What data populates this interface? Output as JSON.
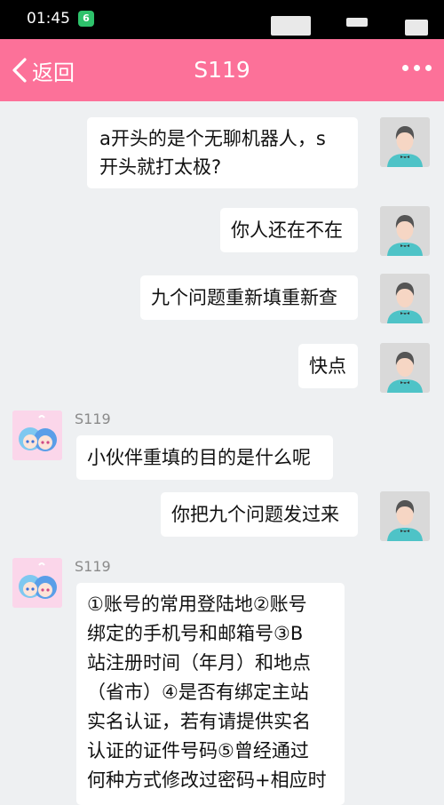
{
  "status_bar": {
    "time": "01:45",
    "app_badge": "6"
  },
  "header": {
    "back_label": "返回",
    "title": "S119"
  },
  "messages": [
    {
      "side": "right",
      "text": "a开头的是个无聊机器人，s\n开头就打太极?"
    },
    {
      "side": "right",
      "text": "你人还在不在"
    },
    {
      "side": "right",
      "text": "九个问题重新填重新查"
    },
    {
      "side": "right",
      "text": "快点"
    },
    {
      "side": "left",
      "sender": "S119",
      "text": "小伙伴重填的目的是什么呢"
    },
    {
      "side": "right",
      "text": "你把九个问题发过来"
    },
    {
      "side": "left",
      "sender": "S119",
      "text": "①账号的常用登陆地②账号\n绑定的手机号和邮箱号③B\n站注册时间（年月）和地点\n（省市）④是否有绑定主站\n实名认证，若有请提供实名\n认证的证件号码⑤曾经通过\n何种方式修改过密码+相应时"
    }
  ]
}
